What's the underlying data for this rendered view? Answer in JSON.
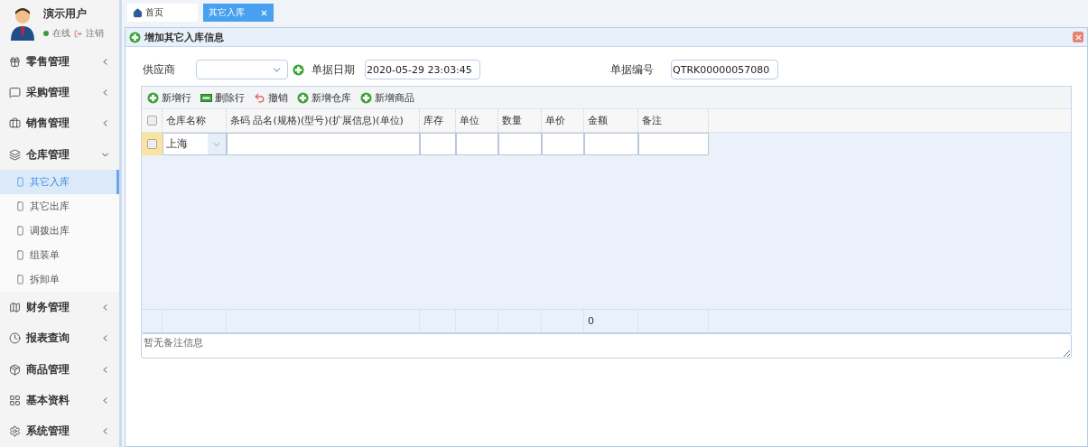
{
  "user": {
    "name": "演示用户",
    "status": "在线",
    "logout": "注销"
  },
  "menu": [
    {
      "label": "零售管理",
      "expanded": false
    },
    {
      "label": "采购管理",
      "expanded": false
    },
    {
      "label": "销售管理",
      "expanded": false
    },
    {
      "label": "仓库管理",
      "expanded": true,
      "children": [
        {
          "label": "其它入库",
          "selected": true
        },
        {
          "label": "其它出库",
          "selected": false
        },
        {
          "label": "调拨出库",
          "selected": false
        },
        {
          "label": "组装单",
          "selected": false
        },
        {
          "label": "拆卸单",
          "selected": false
        }
      ]
    },
    {
      "label": "财务管理",
      "expanded": false
    },
    {
      "label": "报表查询",
      "expanded": false
    },
    {
      "label": "商品管理",
      "expanded": false
    },
    {
      "label": "基本资料",
      "expanded": false
    },
    {
      "label": "系统管理",
      "expanded": false
    }
  ],
  "tabs": [
    {
      "label": "首页",
      "selected": false,
      "kind": "home"
    },
    {
      "label": "其它入库",
      "selected": true,
      "kind": "closable"
    }
  ],
  "panel": {
    "title": "增加其它入库信息"
  },
  "form": {
    "supplier_label": "供应商",
    "date_label": "单据日期",
    "date_value": "2020-05-29 23:03:45",
    "number_label": "单据编号",
    "number_value": "QTRK00000057080"
  },
  "toolbar": [
    {
      "label": "新增行",
      "kind": "add"
    },
    {
      "label": "删除行",
      "kind": "remove"
    },
    {
      "label": "撤销",
      "kind": "undo"
    },
    {
      "label": "新增仓库",
      "kind": "add"
    },
    {
      "label": "新增商品",
      "kind": "add"
    }
  ],
  "table": {
    "all_checked": false,
    "columns": [
      "仓库名称",
      "条码 品名(规格)(型号)(扩展信息)(单位)",
      "库存",
      "单位",
      "数量",
      "单价",
      "金额",
      "备注"
    ],
    "rows": [
      {
        "checked": false,
        "warehouse": "上海"
      }
    ],
    "footer": {
      "amount": "0"
    }
  },
  "remark": {
    "placeholder": "暂无备注信息"
  }
}
